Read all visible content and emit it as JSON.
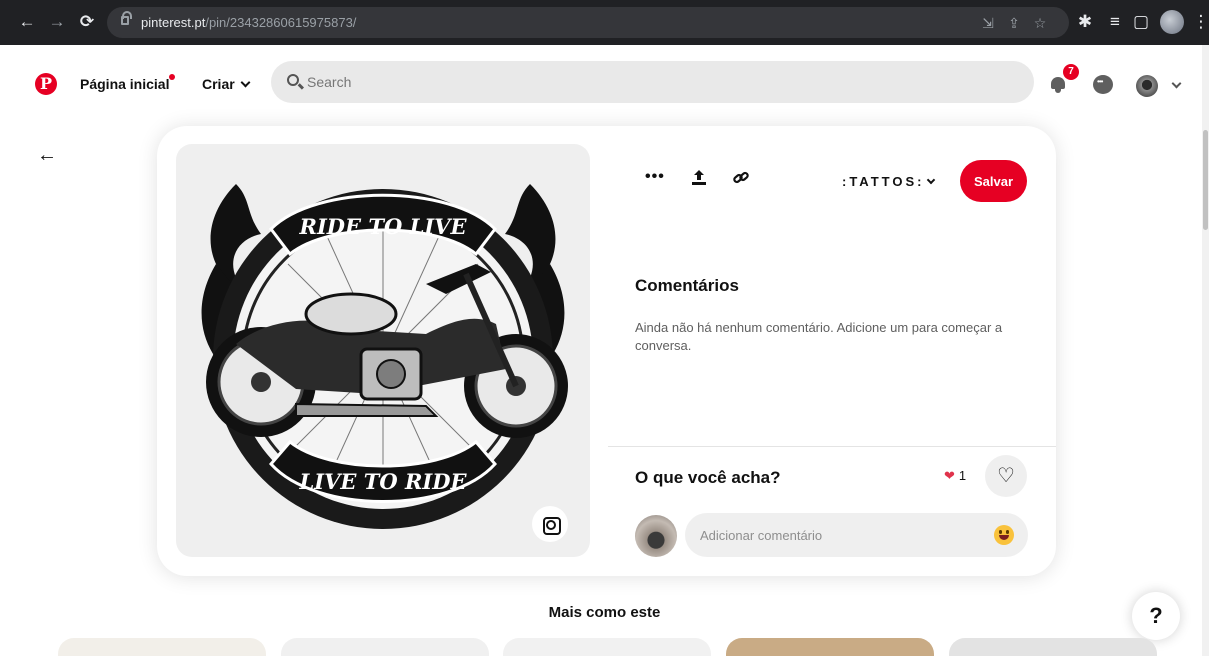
{
  "browser": {
    "url_host": "pinterest.pt",
    "url_path": "/pin/23432860615975873/",
    "back_icon": "arrow-left-icon",
    "forward_icon": "arrow-right-icon",
    "reload_icon": "reload-icon"
  },
  "header": {
    "logo_letter": "P",
    "home_label": "Página inicial",
    "create_label": "Criar",
    "search_placeholder": "Search",
    "notification_count": "7"
  },
  "pin": {
    "image_top_banner": "RIDE TO LIVE",
    "image_bottom_banner": "LIVE TO RIDE",
    "board_name": ":TATTOS:",
    "save_label": "Salvar",
    "more_label": "•••"
  },
  "comments": {
    "title": "Comentários",
    "empty_message": "Ainda não há nenhum comentário. Adicione um para começar a conversa.",
    "prompt": "O que você acha?",
    "reaction_count": "1",
    "input_placeholder": "Adicionar comentário"
  },
  "footer": {
    "more_like_this": "Mais como este",
    "help_label": "?"
  },
  "colors": {
    "brand_red": "#e60023",
    "chrome_dark": "#202124",
    "pane_gray": "#efefef"
  }
}
